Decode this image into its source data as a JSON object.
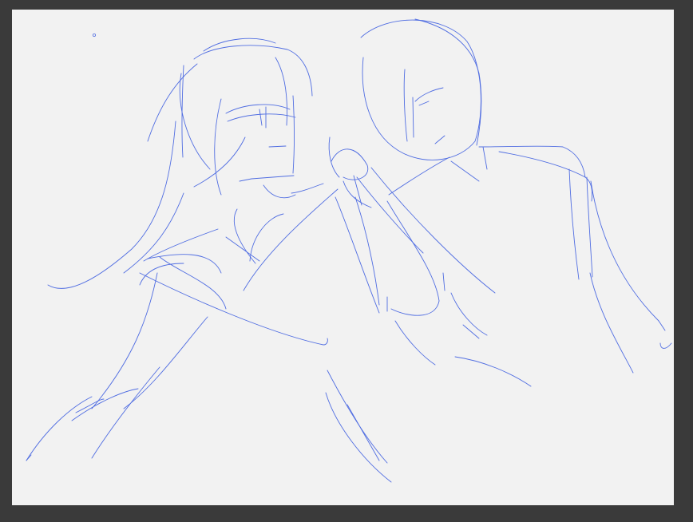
{
  "app": {
    "workspace_color": "#3a3a3a",
    "canvas_color": "#f2f2f2",
    "ink_color": "#3f5fe0",
    "brush_cursor_icon": "brush-cursor-icon"
  }
}
